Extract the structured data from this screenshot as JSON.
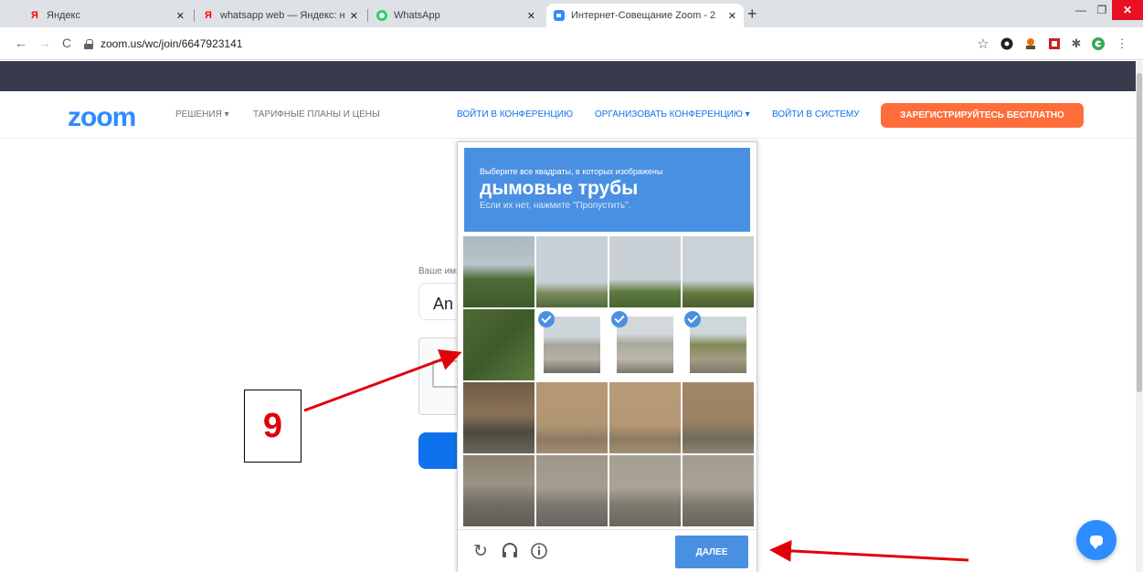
{
  "browser": {
    "tabs": [
      {
        "title": "Яндекс",
        "favicon": "yandex-icon"
      },
      {
        "title": "whatsapp web — Яндекс: нашлос",
        "favicon": "yandex-icon"
      },
      {
        "title": "WhatsApp",
        "favicon": "whatsapp-icon"
      },
      {
        "title": "Интернет-Совещание Zoom - 2",
        "favicon": "zoom-icon",
        "active": true
      }
    ],
    "new_tab": "+",
    "url": "zoom.us/wc/join/6647923141"
  },
  "zoom": {
    "logo": "zoom",
    "nav": {
      "solutions": "РЕШЕНИЯ ▾",
      "plans": "ТАРИФНЫЕ ПЛАНЫ И ЦЕНЫ",
      "join": "ВОЙТИ В КОНФЕРЕНЦИЮ",
      "host": "ОРГАНИЗОВАТЬ КОНФЕРЕНЦИЮ ▾",
      "signin": "ВОЙТИ В СИСТЕМУ",
      "signup": "ЗАРЕГИСТРИРУЙТЕСЬ БЕСПЛАТНО"
    },
    "form": {
      "name_label": "Ваше имя",
      "name_value": "An"
    },
    "colors": {
      "brand": "#2d8cff",
      "signup": "#ff6d3b",
      "topbar": "#393a4c"
    }
  },
  "recaptcha": {
    "instruction": "Выберите все квадраты, в которых изображены",
    "keyword": "дымовые трубы",
    "hint": "Если их нет, нажмите \"Пропустить\".",
    "verify_label": "ДАЛЕЕ",
    "footer_icons": [
      "reload-icon",
      "audio-icon",
      "info-icon"
    ],
    "tiles": [
      {
        "row": 1,
        "col": 1,
        "selected": false
      },
      {
        "row": 1,
        "col": 2,
        "selected": false
      },
      {
        "row": 1,
        "col": 3,
        "selected": false
      },
      {
        "row": 1,
        "col": 4,
        "selected": false
      },
      {
        "row": 2,
        "col": 1,
        "selected": false
      },
      {
        "row": 2,
        "col": 2,
        "selected": true
      },
      {
        "row": 2,
        "col": 3,
        "selected": true
      },
      {
        "row": 2,
        "col": 4,
        "selected": true
      },
      {
        "row": 3,
        "col": 1,
        "selected": false
      },
      {
        "row": 3,
        "col": 2,
        "selected": false
      },
      {
        "row": 3,
        "col": 3,
        "selected": false
      },
      {
        "row": 3,
        "col": 4,
        "selected": false
      },
      {
        "row": 4,
        "col": 1,
        "selected": false
      },
      {
        "row": 4,
        "col": 2,
        "selected": false
      },
      {
        "row": 4,
        "col": 3,
        "selected": false
      },
      {
        "row": 4,
        "col": 4,
        "selected": false
      }
    ],
    "accent": "#4a90e2"
  },
  "annotation": {
    "number": "9",
    "arrow_color": "#e0000a"
  }
}
